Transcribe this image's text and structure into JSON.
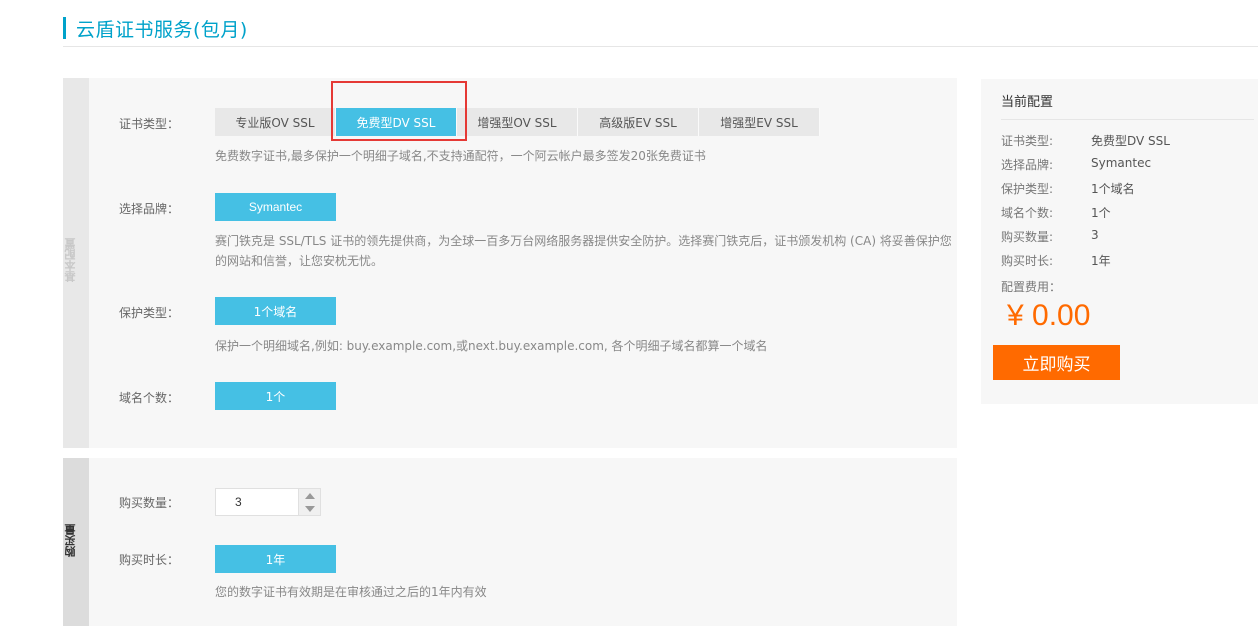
{
  "header": {
    "title": "云盾证书服务(包月)"
  },
  "basic_section": {
    "side_label": "基本配置",
    "cert_type": {
      "label": "证书类型：",
      "tabs": [
        "专业版OV SSL",
        "免费型DV SSL",
        "增强型OV SSL",
        "高级版EV SSL",
        "增强型EV SSL"
      ],
      "selected": "免费型DV SSL",
      "hint": "免费数字证书,最多保护一个明细子域名,不支持通配符，一个阿云帐户最多签发20张免费证书"
    },
    "brand": {
      "label": "选择品牌：",
      "value": "Symantec",
      "hint": "赛门铁克是 SSL/TLS 证书的领先提供商，为全球一百多万台网络服务器提供安全防护。选择赛门铁克后，证书颁发机构 (CA) 将妥善保护您的网站和信誉，让您安枕无忧。"
    },
    "protect_type": {
      "label": "保护类型：",
      "value": "1个域名",
      "hint": "保护一个明细域名,例如: buy.example.com,或next.buy.example.com, 各个明细子域名都算一个域名"
    },
    "domain_count": {
      "label": "域名个数：",
      "value": "1个"
    }
  },
  "purchase_section": {
    "side_label": "购买量",
    "quantity": {
      "label": "购买数量：",
      "value": "3"
    },
    "duration": {
      "label": "购买时长：",
      "value": "1年",
      "hint": "您的数字证书有效期是在审核通过之后的1年内有效"
    }
  },
  "config_panel": {
    "title": "当前配置",
    "rows": [
      {
        "label": "证书类型:",
        "value": "免费型DV SSL"
      },
      {
        "label": "选择品牌:",
        "value": "Symantec"
      },
      {
        "label": "保护类型:",
        "value": "1个域名"
      },
      {
        "label": "域名个数:",
        "value": "1个"
      },
      {
        "label": "购买数量:",
        "value": "3"
      },
      {
        "label": "购买时长:",
        "value": "1年"
      }
    ],
    "fee_label": "配置费用：",
    "price": "¥ 0.00",
    "buy_label": "立即购买"
  },
  "colors": {
    "accent": "#45c0e4",
    "title": "#00a2ca",
    "price": "#ff6a00",
    "highlight": "#e53935"
  }
}
